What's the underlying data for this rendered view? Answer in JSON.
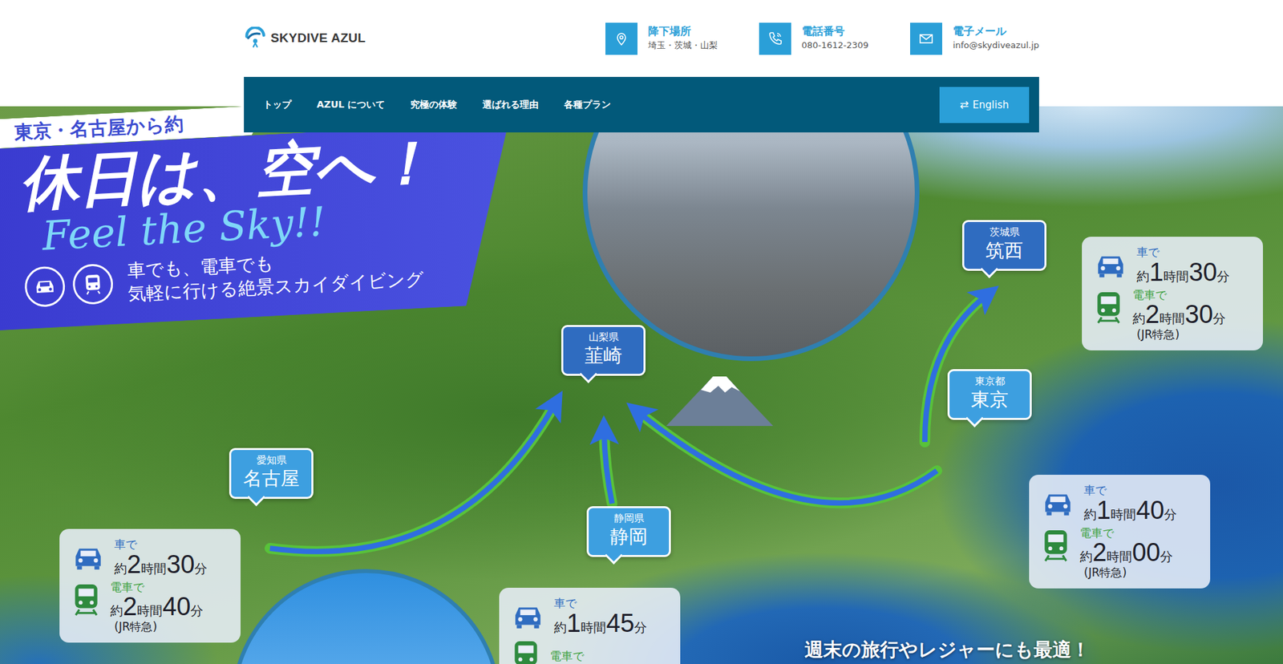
{
  "logo": {
    "text": "SKYDIVE AZUL"
  },
  "contacts": [
    {
      "kind": "location",
      "title": "降下場所",
      "value": "埼玉・茨城・山梨"
    },
    {
      "kind": "phone",
      "title": "電話番号",
      "value": "080-1612-2309"
    },
    {
      "kind": "mail",
      "title": "電子メール",
      "value": "info@skydiveazul.jp"
    }
  ],
  "nav": {
    "items": [
      {
        "label": "トップ",
        "selected": false
      },
      {
        "label": "AZUL について",
        "selected": false
      },
      {
        "label": "究極の体験",
        "selected": false
      },
      {
        "label": "選ばれる理由",
        "selected": false
      },
      {
        "label": "各種プラン",
        "selected": false
      }
    ],
    "language_button": {
      "icon": "⇄",
      "label": "English"
    }
  },
  "hero": {
    "ribbon": {
      "kicker": "東京・名古屋から約",
      "title": "休日は、空へ！",
      "script": "Feel the Sky!!",
      "lines": [
        "車でも、電車でも",
        "気軽に行ける絶景スカイダイビング"
      ]
    },
    "pins": [
      {
        "prefecture": "茨城県",
        "city": "筑西",
        "color": "#2f6cc0"
      },
      {
        "prefecture": "山梨県",
        "city": "韮崎",
        "color": "#2f6cc0"
      },
      {
        "prefecture": "東京都",
        "city": "東京",
        "color": "#3d9fe0"
      },
      {
        "prefecture": "愛知県",
        "city": "名古屋",
        "color": "#3d9fe0"
      },
      {
        "prefecture": "静岡県",
        "city": "静岡",
        "color": "#3d9fe0"
      }
    ],
    "travel_cards": [
      {
        "rows": [
          {
            "kind": "car",
            "label": "車で",
            "time": "約1時間30分"
          },
          {
            "kind": "train",
            "label": "電車で",
            "time": "約2時間30分"
          }
        ],
        "note": "(JR特急)"
      },
      {
        "rows": [
          {
            "kind": "car",
            "label": "車で",
            "time": "約1時間40分"
          },
          {
            "kind": "train",
            "label": "電車で",
            "time": "約2時間00分"
          }
        ],
        "note": "(JR特急)"
      },
      {
        "rows": [
          {
            "kind": "car",
            "label": "車で",
            "time": "約2時間30分"
          },
          {
            "kind": "train",
            "label": "電車で",
            "time": "約2時間40分"
          }
        ],
        "note": "(JR特急)"
      },
      {
        "rows": [
          {
            "kind": "car",
            "label": "車で",
            "time": "約1時間45分"
          },
          {
            "kind": "train",
            "label": "電車で"
          }
        ]
      }
    ],
    "tagline": "週末の旅行やレジャーにも最適！"
  }
}
